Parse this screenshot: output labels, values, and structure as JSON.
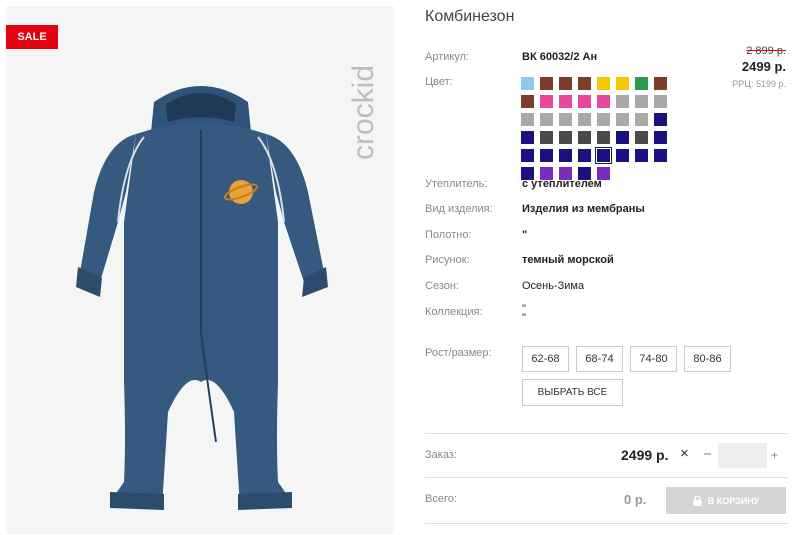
{
  "product": {
    "title": "Комбинезон",
    "sale_badge": "SALE",
    "brand_logo": "crockid",
    "article_label": "Артикул:",
    "article_value": "ВК 60032/2 Ан",
    "color_label": "Цвет:",
    "old_price": "2 899 р.",
    "price": "2499 р.",
    "rrp": "РРЦ: 5199 р.",
    "attributes": [
      {
        "label": "Утеплитель:",
        "value": "с утеплителем"
      },
      {
        "label": "Вид изделия:",
        "value": "Изделия из мембраны"
      },
      {
        "label": "Полотно:",
        "value": "\""
      },
      {
        "label": "Рисунок:",
        "value": "темный морской"
      },
      {
        "label": "Сезон:",
        "value": "Осень-Зима"
      },
      {
        "label": "Коллекция:",
        "value": "\"\n\""
      }
    ]
  },
  "colors": {
    "accent": "#e3000f",
    "swatches": [
      "#8ec9f0",
      "#7a3e2b",
      "#7a3e2b",
      "#7a3e2b",
      "#f5c800",
      "#f5c800",
      "#2e9a4f",
      "#7a3e2b",
      "#7a3e2b",
      "#e8489a",
      "#e8489a",
      "#e8489a",
      "#e8489a",
      "#a9a9a9",
      "#a9a9a9",
      "#a9a9a9",
      "#a9a9a9",
      "#a9a9a9",
      "#a9a9a9",
      "#a9a9a9",
      "#a9a9a9",
      "#a9a9a9",
      "#a9a9a9",
      "#1c1180",
      "#1c1180",
      "#4a4a4a",
      "#4a4a4a",
      "#4a4a4a",
      "#4a4a4a",
      "#1c1180",
      "#4a4a4a",
      "#1c1180",
      "#1c1180",
      "#1c1180",
      "#1c1180",
      "#1c1180",
      "#1c1180",
      "#1c1180",
      "#1c1180",
      "#1c1180",
      "#1c1180",
      "#7a2dbd",
      "#7a2dbd",
      "#1c1180",
      "#7a2dbd"
    ],
    "selected_index": 36
  },
  "sizes": {
    "label": "Рост/размер:",
    "options": [
      "62-68",
      "68-74",
      "74-80",
      "80-86"
    ],
    "select_all": "ВЫБРАТЬ ВСЕ"
  },
  "order": {
    "label": "Заказ:",
    "price": "2499 р.",
    "times": "×",
    "minus": "−",
    "plus": "+",
    "quantity": ""
  },
  "total": {
    "label": "Всего:",
    "value": "0 р.",
    "cart_button": "В КОРЗИНУ"
  }
}
